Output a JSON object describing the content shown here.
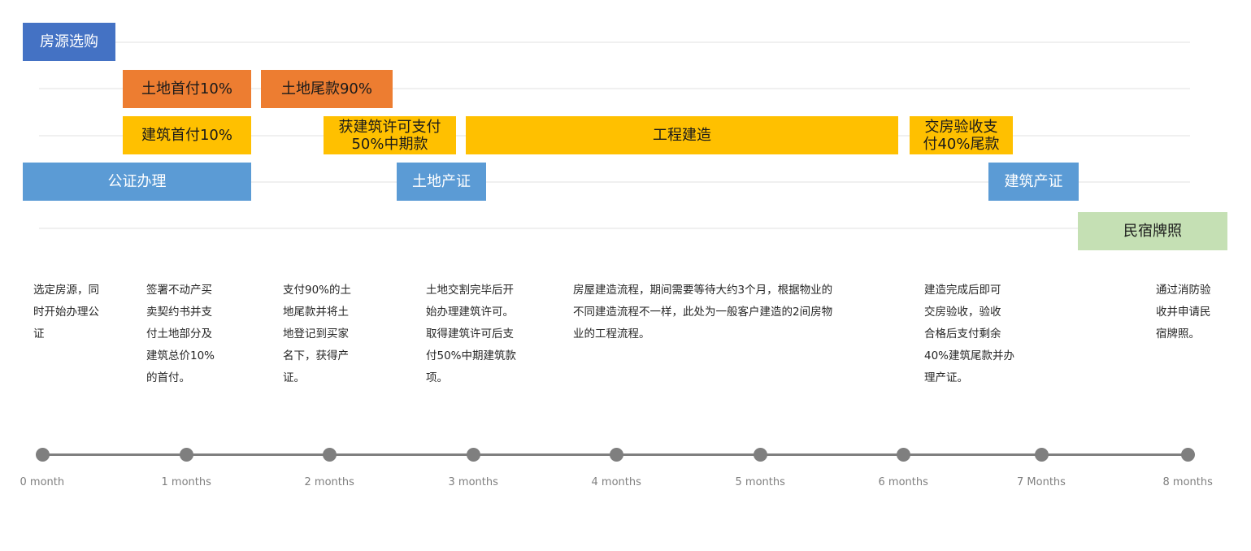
{
  "phases": {
    "house_selection": "房源选购",
    "land_down_payment": "土地首付10%",
    "land_final_payment": "土地尾款90%",
    "build_down_payment": "建筑首付10%",
    "permit_mid_payment": "获建筑许可支付\n50%中期款",
    "construction": "工程建造",
    "handover_final_payment": "交房验收支\n付40%尾款",
    "notary": "公证办理",
    "land_certificate": "土地产证",
    "building_certificate": "建筑产证",
    "bnb_license": "民宿牌照"
  },
  "descriptions": [
    "选定房源，同\n时开始办理公\n证",
    "签署不动产买\n卖契约书并支\n付土地部分及\n建筑总价10%\n的首付。",
    "支付90%的土\n地尾款并将土\n地登记到买家\n名下，获得产\n证。",
    "土地交割完毕后开\n始办理建筑许可。\n取得建筑许可后支\n付50%中期建筑款\n项。",
    "房屋建造流程，期间需要等待大约3个月，根据物业的\n不同建造流程不一样，此处为一般客户建造的2间房物\n业的工程流程。",
    "建造完成后即可\n交房验收，验收\n合格后支付剩余\n40%建筑尾款并办\n理产证。",
    "通过消防验\n收并申请民\n宿牌照。"
  ],
  "timeline": {
    "ticks": [
      "0 month",
      "1 months",
      "2 months",
      "3 months",
      "4 months",
      "5 months",
      "6 months",
      "7 Months",
      "8 months"
    ]
  },
  "colors": {
    "selection": "#4472c4",
    "certificate": "#5b9bd5",
    "land_payment": "#ed7d31",
    "build_payment": "#ffc000",
    "license": "#c5e0b4",
    "axis": "#7f7f7f"
  }
}
